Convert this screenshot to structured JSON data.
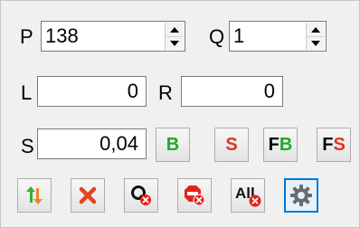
{
  "fields": {
    "p": {
      "label": "P",
      "value": "138"
    },
    "q": {
      "label": "Q",
      "value": "1"
    },
    "l": {
      "label": "L",
      "value": "0"
    },
    "r": {
      "label": "R",
      "value": "0"
    },
    "s": {
      "label": "S",
      "value": "0,04"
    }
  },
  "buttons": {
    "b": {
      "label": "B",
      "color": "#22a82b"
    },
    "s": {
      "label": "S",
      "color": "#e1341e"
    },
    "fb": {
      "label_f": "F",
      "label_b": "B",
      "color_f": "#000000",
      "color_b": "#22a82b"
    },
    "fs": {
      "label_f": "F",
      "label_s": "S",
      "color_f": "#000000",
      "color_s": "#e1341e"
    }
  },
  "toolbar": {
    "icons": [
      "swap-arrows-icon",
      "cancel-x-icon",
      "cancel-q-icon",
      "cancel-stop-icon",
      "cancel-all-icon",
      "settings-gear-icon"
    ],
    "all_label": "All"
  },
  "colors": {
    "green": "#22a82b",
    "red": "#e1341e",
    "focus": "#0078d7"
  }
}
